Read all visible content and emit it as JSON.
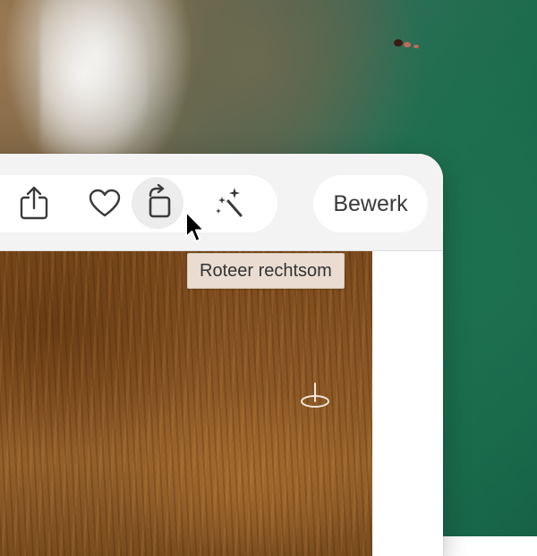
{
  "toolbar": {
    "buttons": [
      {
        "icon": "share-icon"
      },
      {
        "icon": "heart-icon"
      },
      {
        "icon": "rotate-clockwise-icon",
        "state": "hovered"
      },
      {
        "icon": "magic-wand-icon"
      }
    ],
    "edit_label": "Bewerk"
  },
  "tooltip": {
    "text": "Roteer rechtsom"
  },
  "colors": {
    "toolbar_bg": "#f3f3f3",
    "button_bg": "#ffffff",
    "hover_bg": "#ececec",
    "icon": "#3a3a3a",
    "tooltip_bg": "#eadcd1"
  }
}
